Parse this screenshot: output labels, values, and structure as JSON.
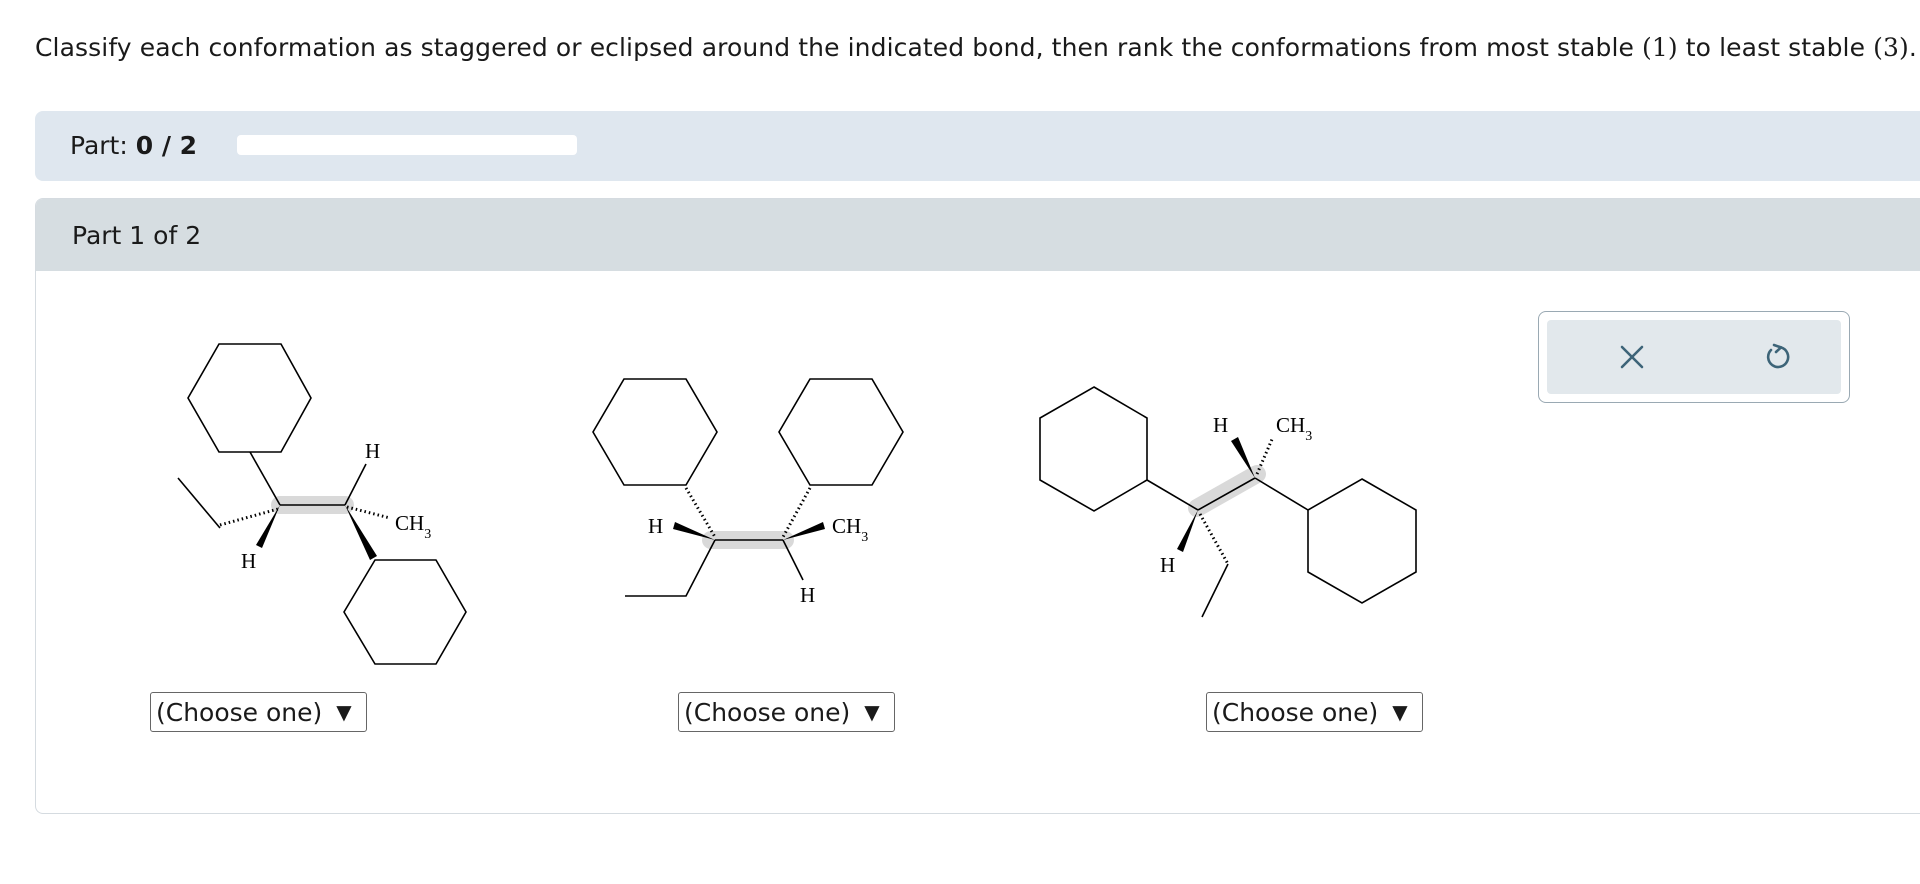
{
  "instructions": {
    "text_before": "Classify each conformation as staggered or eclipsed around the indicated bond, then rank the conformations from most stable ",
    "num1": "(1)",
    "text_mid": " to least stable ",
    "num3": "(3)",
    "text_after": "."
  },
  "progress": {
    "label": "Part: ",
    "value": "0 / 2",
    "fraction": 0
  },
  "part": {
    "title": "Part 1 of 2"
  },
  "molecules": {
    "m1": {
      "h_top": "H",
      "ch": "CH",
      "sub": "3",
      "h_bottom": "H"
    },
    "m2": {
      "h_left": "H",
      "ch": "CH",
      "sub": "3",
      "h_bottom": "H"
    },
    "m3": {
      "h_top": "H",
      "ch": "CH",
      "sub": "3",
      "h_bottom": "H"
    }
  },
  "selects": [
    {
      "value": "(Choose one)"
    },
    {
      "value": "(Choose one)"
    },
    {
      "value": "(Choose one)"
    }
  ],
  "toolbar": {
    "clear_icon": "close-icon",
    "undo_icon": "undo-icon"
  },
  "colors": {
    "panel": "#dfe7ef",
    "part_header": "#d6dde1",
    "highlight": "#d9d9d9",
    "tool_icon": "#3d6478"
  }
}
